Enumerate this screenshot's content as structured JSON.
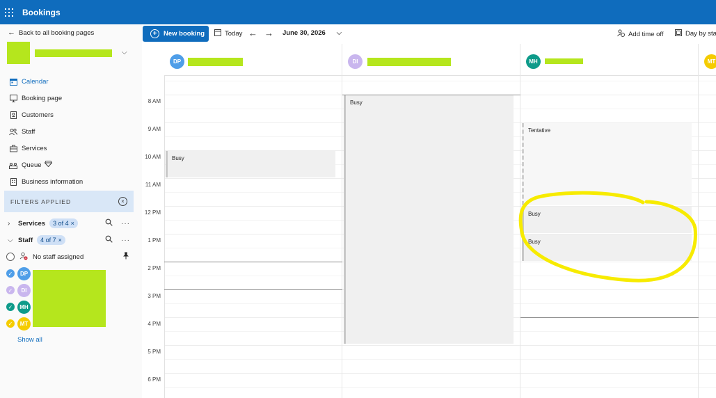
{
  "app": {
    "title": "Bookings"
  },
  "sidebar": {
    "back_label": "Back to all booking pages",
    "nav": [
      {
        "label": "Calendar",
        "icon": "calendar-icon",
        "active": true
      },
      {
        "label": "Booking page",
        "icon": "monitor-icon"
      },
      {
        "label": "Customers",
        "icon": "contact-card-icon"
      },
      {
        "label": "Staff",
        "icon": "people-icon"
      },
      {
        "label": "Services",
        "icon": "briefcase-icon"
      },
      {
        "label": "Queue",
        "icon": "queue-icon"
      },
      {
        "label": "Business information",
        "icon": "building-icon"
      }
    ],
    "filters_label": "FILTERS APPLIED",
    "services_filter": {
      "label": "Services",
      "badge": "3 of 4"
    },
    "staff_filter": {
      "label": "Staff",
      "badge": "4 of 7"
    },
    "no_staff_label": "No staff assigned",
    "staff": [
      {
        "initials": "DP",
        "color": "#4f9ee8",
        "checked": true
      },
      {
        "initials": "DI",
        "color": "#c9b6ee",
        "checked": true
      },
      {
        "initials": "MH",
        "color": "#0e9b8a",
        "checked": true
      },
      {
        "initials": "MT",
        "color": "#f5cc00",
        "checked": true
      }
    ],
    "show_all": "Show all"
  },
  "toolbar": {
    "new_booking": "New booking",
    "today": "Today",
    "date": "June 30, 2026",
    "add_time_off": "Add time off",
    "view": "Day by staff"
  },
  "calendar": {
    "hours": [
      "8 AM",
      "9 AM",
      "10 AM",
      "11 AM",
      "12 PM",
      "1 PM",
      "2 PM",
      "3 PM",
      "4 PM",
      "5 PM",
      "6 PM"
    ],
    "columns": [
      {
        "initials": "DP",
        "color": "#4f9ee8"
      },
      {
        "initials": "DI",
        "color": "#c9b6ee"
      },
      {
        "initials": "MH",
        "color": "#0e9b8a"
      },
      {
        "initials": "MT",
        "color": "#f5cc00"
      }
    ],
    "events": [
      {
        "label": "Busy"
      },
      {
        "label": "Busy"
      },
      {
        "label": "Tentative"
      },
      {
        "label": "Busy"
      },
      {
        "label": "Busy"
      }
    ]
  }
}
